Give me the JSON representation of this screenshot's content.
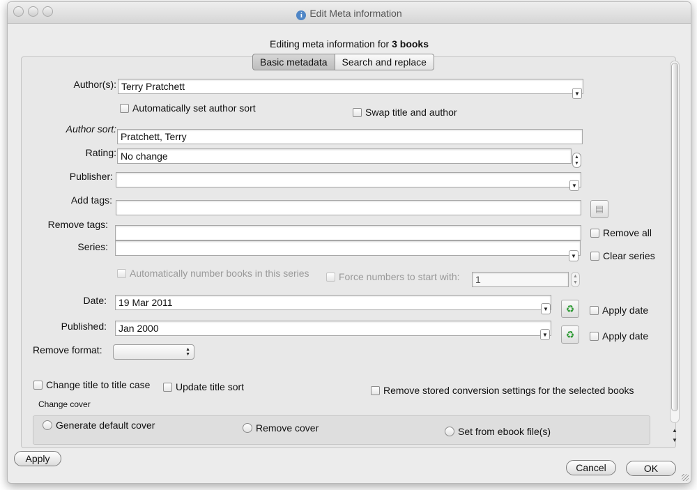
{
  "window": {
    "title": "Edit Meta information"
  },
  "heading": {
    "prefix": "Editing meta information for",
    "count": "3 books"
  },
  "tabs": [
    {
      "label": "Basic metadata"
    },
    {
      "label": "Search and replace"
    }
  ],
  "form": {
    "authors": {
      "label": "Author(s):",
      "value": "Terry Pratchett"
    },
    "auto_author_sort": "Automatically set author sort",
    "swap_title_author": "Swap title and author",
    "author_sort": {
      "label": "Author sort:",
      "value": "Pratchett, Terry"
    },
    "rating": {
      "label": "Rating:",
      "value": "No change"
    },
    "publisher": {
      "label": "Publisher:",
      "value": ""
    },
    "add_tags": {
      "label": "Add tags:",
      "value": ""
    },
    "remove_tags": {
      "label": "Remove tags:",
      "value": ""
    },
    "remove_all": "Remove all",
    "series": {
      "label": "Series:",
      "value": ""
    },
    "clear_series": "Clear series",
    "auto_number": "Automatically number books in this series",
    "force_numbers": "Force numbers to start with:",
    "force_start": "1",
    "date": {
      "label": "Date:",
      "value": "19 Mar 2011"
    },
    "published": {
      "label": "Published:",
      "value": "Jan 2000"
    },
    "apply_date": "Apply date",
    "apply_published": "Apply date",
    "remove_format": {
      "label": "Remove format:",
      "value": ""
    },
    "change_title_case": "Change title to title case",
    "update_title_sort": "Update title sort",
    "remove_conversion": "Remove stored conversion settings for the selected books",
    "change_cover": "Change cover",
    "generate_cover": "Generate default cover",
    "remove_cover": "Remove cover",
    "set_from_ebook": "Set from ebook file(s)"
  },
  "buttons": {
    "apply": "Apply",
    "cancel": "Cancel",
    "ok": "OK"
  }
}
